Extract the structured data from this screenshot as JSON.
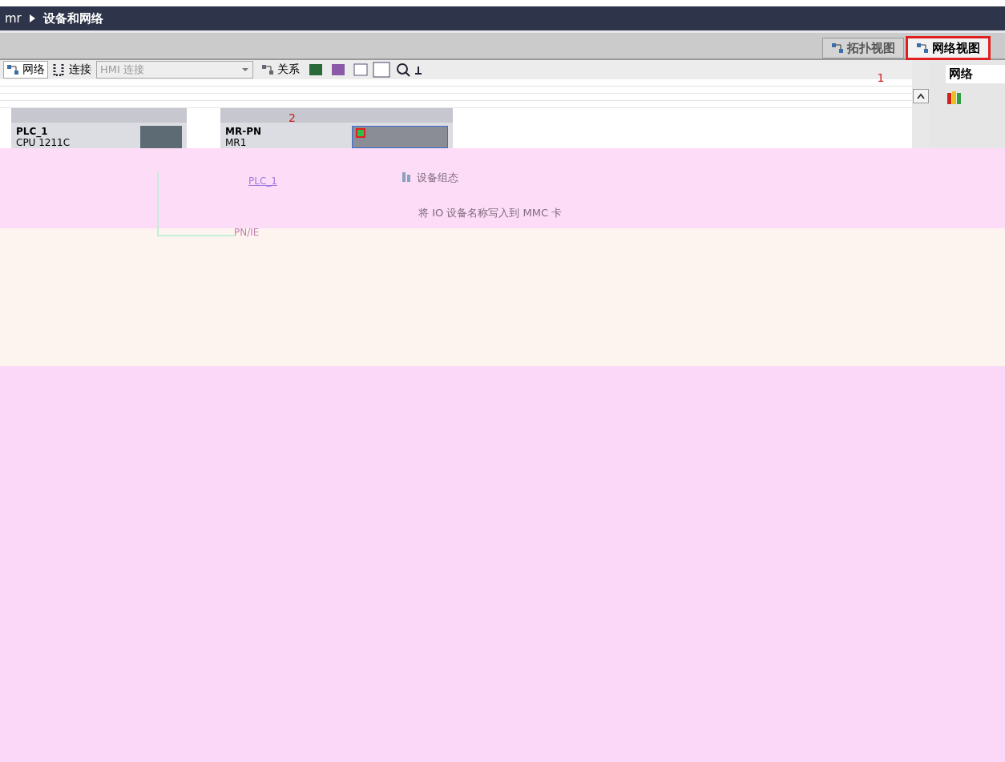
{
  "breadcrumb": {
    "project": "mr",
    "page": "设备和网络"
  },
  "view_tabs": [
    {
      "label": "拓扑视图",
      "selected": false
    },
    {
      "label": "网络视图",
      "selected": true
    }
  ],
  "toolbar": {
    "network_button": "网络",
    "connections_label": "连接",
    "connection_type": "HMI 连接",
    "relations_button": "关系"
  },
  "annotations": [
    "1",
    "2"
  ],
  "devices": [
    {
      "name": "PLC_1",
      "type": "CPU 1211C"
    },
    {
      "name": "MR-PN",
      "type": "MR1"
    }
  ],
  "side_panel": {
    "tab": "网络"
  },
  "popup": {
    "link": "PLC_1",
    "subnet": "PN/IE"
  },
  "context_menu": [
    "设备组态",
    "将 IO 设备名称写入到 MMC 卡"
  ]
}
